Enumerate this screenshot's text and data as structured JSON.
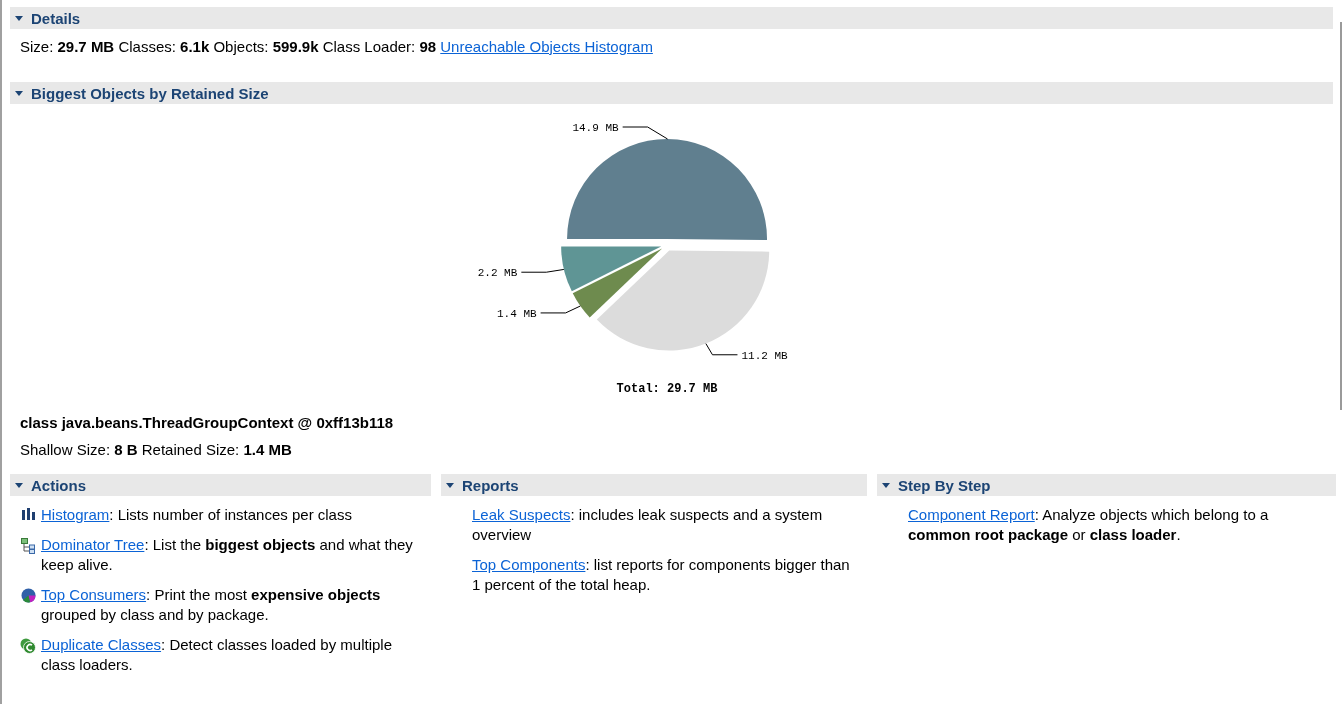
{
  "details": {
    "title": "Details",
    "expanded": true,
    "summary": "Size: **29.7 MB** Classes: **6.1k** Objects: **599.9k** Class Loader: **98**",
    "link": "Unreachable Objects Histogram"
  },
  "biggest_objects": {
    "title": "Biggest Objects by Retained Size",
    "expanded": true,
    "chart_data": {
      "type": "pie",
      "values": [
        14.9,
        11.2,
        1.4,
        2.2
      ],
      "colors": [
        "#607f8f",
        "#dcdcdc",
        "#6e8b4e",
        "#5f9595"
      ],
      "value_labels": [
        "14.9 MB",
        "11.2 MB",
        "1.4 MB",
        "2.2 MB"
      ],
      "title": "Total: 29.7 MB"
    },
    "object_name": "class java.beans.ThreadGroupContext @ 0xff13b118",
    "object_sizes": "Shallow Size: **8 B** Retained Size: **1.4 MB**"
  },
  "panels": [
    {
      "title": "Actions",
      "expanded": true,
      "items": [
        {
          "kind": "histogram",
          "link": "Histogram",
          "text": ": Lists number of instances per class"
        },
        {
          "kind": "tree",
          "link": "Dominator Tree",
          "text": ": List the **biggest objects** and what they keep alive."
        },
        {
          "kind": "pie",
          "link": "Top Consumers",
          "text": ": Print the most **expensive objects** grouped by class and by package."
        },
        {
          "kind": "class",
          "link": "Duplicate Classes",
          "text": ": Detect classes loaded by multiple class loaders."
        }
      ]
    },
    {
      "title": "Reports",
      "expanded": true,
      "items": [
        {
          "kind": "plain",
          "link": "Leak Suspects",
          "text": ": includes leak suspects and a system overview"
        },
        {
          "kind": "plain",
          "link": "Top Components",
          "text": ": list reports for components bigger than 1 percent of the total heap."
        }
      ]
    },
    {
      "title": "Step By Step",
      "expanded": true,
      "items": [
        {
          "kind": "plain",
          "link": "Component Report",
          "text": ": Analyze objects which belong to a **common root package** or **class loader**."
        }
      ]
    }
  ]
}
